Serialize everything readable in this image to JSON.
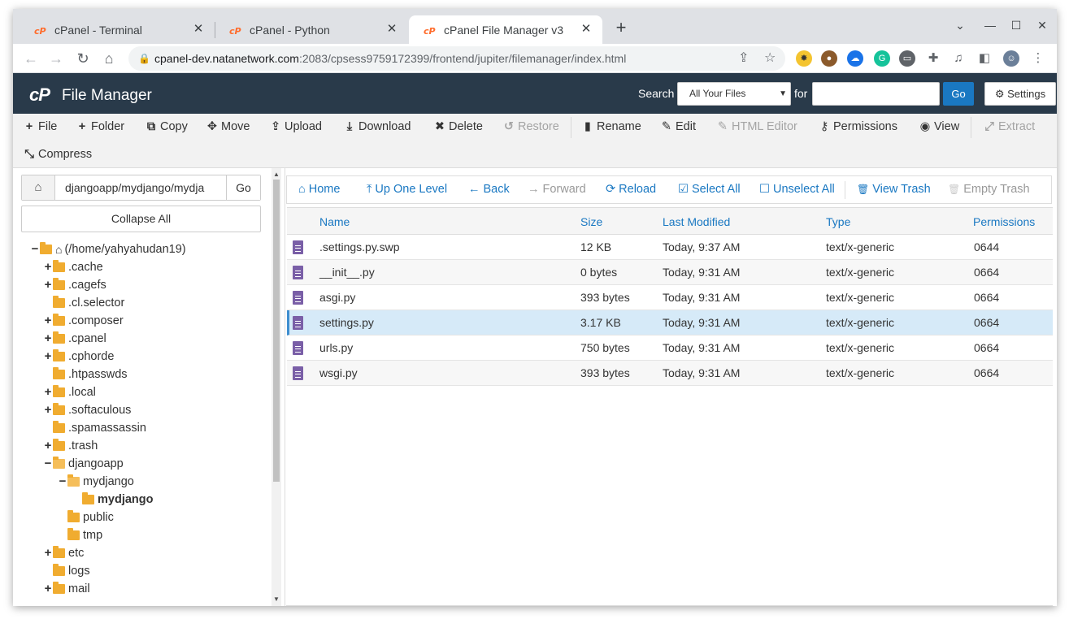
{
  "browser": {
    "tabs": [
      {
        "title": "cPanel - Terminal"
      },
      {
        "title": "cPanel - Python"
      },
      {
        "title": "cPanel File Manager v3"
      }
    ],
    "new_tab_label": "+",
    "close_glyph": "✕",
    "url_host": "cpanel-dev.natanetwork.com",
    "url_rest": ":2083/cpsess9759172399/frontend/jupiter/filemanager/index.html",
    "icons": [
      "back-arrow-icon",
      "forward-arrow-icon",
      "reload-icon",
      "home-icon",
      "lock-icon",
      "share-icon",
      "star-icon",
      "extensions-icon",
      "profile-avatar-icon"
    ]
  },
  "header": {
    "logo": "cP",
    "title": "File Manager",
    "search_label": "Search",
    "search_scope": "All Your Files",
    "for_label": "for",
    "go_label": "Go",
    "settings_label": "Settings"
  },
  "actions": [
    {
      "label": "File",
      "icon": "+",
      "disabled": false
    },
    {
      "label": "Folder",
      "icon": "+",
      "disabled": false
    },
    {
      "label": "Copy",
      "icon": "⧉",
      "disabled": false
    },
    {
      "label": "Move",
      "icon": "✥",
      "disabled": false
    },
    {
      "label": "Upload",
      "icon": "⇪",
      "disabled": false
    },
    {
      "label": "Download",
      "icon": "⤓",
      "disabled": false
    },
    {
      "label": "Delete",
      "icon": "✖",
      "disabled": false
    },
    {
      "label": "Restore",
      "icon": "↺",
      "disabled": true
    },
    {
      "label": "Rename",
      "icon": "▮",
      "disabled": false
    },
    {
      "label": "Edit",
      "icon": "✎",
      "disabled": false
    },
    {
      "label": "HTML Editor",
      "icon": "✎",
      "disabled": true
    },
    {
      "label": "Permissions",
      "icon": "⚷",
      "disabled": false
    },
    {
      "label": "View",
      "icon": "◉",
      "disabled": false
    },
    {
      "label": "Extract",
      "icon": "⤢",
      "disabled": true
    },
    {
      "label": "Compress",
      "icon": "⤡",
      "disabled": false
    }
  ],
  "left": {
    "path_value": "djangoapp/mydjango/mydja",
    "go_label": "Go",
    "collapse_label": "Collapse All",
    "tree": [
      {
        "label": "(/home/yahyahudan19)",
        "toggle": "−",
        "depth": 0,
        "home": true
      },
      {
        "label": ".cache",
        "toggle": "+",
        "depth": 1
      },
      {
        "label": ".cagefs",
        "toggle": "+",
        "depth": 1
      },
      {
        "label": ".cl.selector",
        "toggle": "",
        "depth": 1
      },
      {
        "label": ".composer",
        "toggle": "+",
        "depth": 1
      },
      {
        "label": ".cpanel",
        "toggle": "+",
        "depth": 1
      },
      {
        "label": ".cphorde",
        "toggle": "+",
        "depth": 1
      },
      {
        "label": ".htpasswds",
        "toggle": "",
        "depth": 1
      },
      {
        "label": ".local",
        "toggle": "+",
        "depth": 1
      },
      {
        "label": ".softaculous",
        "toggle": "+",
        "depth": 1
      },
      {
        "label": ".spamassassin",
        "toggle": "",
        "depth": 1
      },
      {
        "label": ".trash",
        "toggle": "+",
        "depth": 1
      },
      {
        "label": "djangoapp",
        "toggle": "−",
        "depth": 1,
        "open": true
      },
      {
        "label": "mydjango",
        "toggle": "−",
        "depth": 2,
        "open": true
      },
      {
        "label": "mydjango",
        "toggle": "",
        "depth": 3,
        "bold": true
      },
      {
        "label": "public",
        "toggle": "",
        "depth": 2
      },
      {
        "label": "tmp",
        "toggle": "",
        "depth": 2
      },
      {
        "label": "etc",
        "toggle": "+",
        "depth": 1
      },
      {
        "label": "logs",
        "toggle": "",
        "depth": 1
      },
      {
        "label": "mail",
        "toggle": "+",
        "depth": 1
      }
    ]
  },
  "nav": [
    {
      "label": "Home",
      "icon": "⌂",
      "disabled": false
    },
    {
      "label": "Up One Level",
      "icon": "⤒",
      "disabled": false
    },
    {
      "label": "Back",
      "icon": "←",
      "disabled": false
    },
    {
      "label": "Forward",
      "icon": "→",
      "disabled": true
    },
    {
      "label": "Reload",
      "icon": "⟳",
      "disabled": false
    },
    {
      "label": "Select All",
      "icon": "☑",
      "disabled": false
    },
    {
      "label": "Unselect All",
      "icon": "☐",
      "disabled": false
    },
    {
      "label": "View Trash",
      "icon": "🗑",
      "disabled": false
    },
    {
      "label": "Empty Trash",
      "icon": "🗑",
      "disabled": true
    }
  ],
  "table": {
    "columns": [
      "Name",
      "Size",
      "Last Modified",
      "Type",
      "Permissions"
    ],
    "rows": [
      {
        "name": ".settings.py.swp",
        "size": "12 KB",
        "modified": "Today, 9:37 AM",
        "type": "text/x-generic",
        "perms": "0644"
      },
      {
        "name": "__init__.py",
        "size": "0 bytes",
        "modified": "Today, 9:31 AM",
        "type": "text/x-generic",
        "perms": "0664"
      },
      {
        "name": "asgi.py",
        "size": "393 bytes",
        "modified": "Today, 9:31 AM",
        "type": "text/x-generic",
        "perms": "0664"
      },
      {
        "name": "settings.py",
        "size": "3.17 KB",
        "modified": "Today, 9:31 AM",
        "type": "text/x-generic",
        "perms": "0664",
        "selected": true
      },
      {
        "name": "urls.py",
        "size": "750 bytes",
        "modified": "Today, 9:31 AM",
        "type": "text/x-generic",
        "perms": "0664"
      },
      {
        "name": "wsgi.py",
        "size": "393 bytes",
        "modified": "Today, 9:31 AM",
        "type": "text/x-generic",
        "perms": "0664"
      }
    ]
  },
  "colors": {
    "header_bg": "#293a4a",
    "accent": "#1a78c2",
    "folder": "#f0ac30",
    "file_icon": "#7a5fa7",
    "selected_row": "#d6eaf8"
  }
}
